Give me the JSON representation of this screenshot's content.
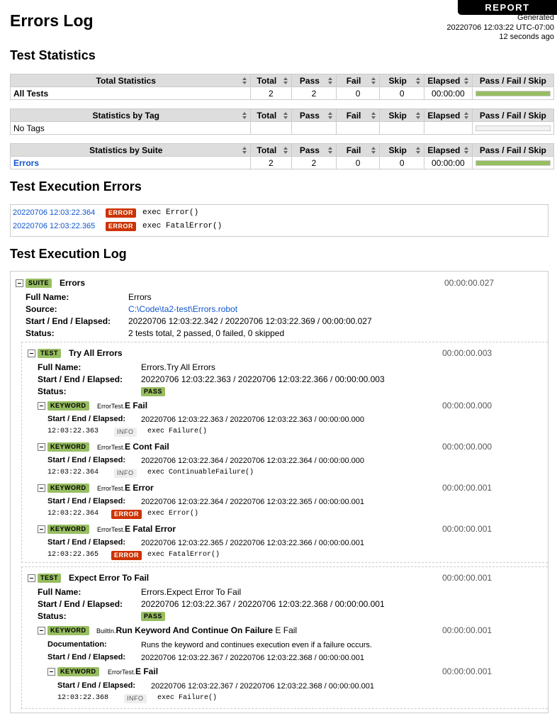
{
  "header": {
    "report_link": "REPORT",
    "title": "Errors Log",
    "generated_label": "Generated",
    "generated_time": "20220706 12:03:22 UTC-07:00",
    "generated_ago": "12 seconds ago"
  },
  "statistics": {
    "heading": "Test Statistics",
    "columns": [
      "Total",
      "Pass",
      "Fail",
      "Skip",
      "Elapsed",
      "Pass / Fail / Skip"
    ],
    "total": {
      "header": "Total Statistics",
      "row": {
        "name": "All Tests",
        "total": "2",
        "pass": "2",
        "fail": "0",
        "skip": "0",
        "elapsed": "00:00:00",
        "pass_ratio": 1.0
      }
    },
    "tag": {
      "header": "Statistics by Tag",
      "row": {
        "name": "No Tags",
        "total": "",
        "pass": "",
        "fail": "",
        "skip": "",
        "elapsed": "",
        "pass_ratio": 0
      }
    },
    "suite": {
      "header": "Statistics by Suite",
      "row": {
        "name": "Errors",
        "total": "2",
        "pass": "2",
        "fail": "0",
        "skip": "0",
        "elapsed": "00:00:00",
        "pass_ratio": 1.0
      }
    }
  },
  "execution_errors": {
    "heading": "Test Execution Errors",
    "rows": [
      {
        "timestamp": "20220706 12:03:22.364",
        "level": "ERROR",
        "message": "exec Error()"
      },
      {
        "timestamp": "20220706 12:03:22.365",
        "level": "ERROR",
        "message": "exec FatalError()"
      }
    ]
  },
  "log": {
    "heading": "Test Execution Log",
    "suite": {
      "label": "SUITE",
      "name": "Errors",
      "elapsed": "00:00:00.027",
      "full_name_key": "Full Name:",
      "full_name": "Errors",
      "source_key": "Source:",
      "source": "C:\\Code\\ta2-test\\Errors.robot",
      "times_key": "Start / End / Elapsed:",
      "times": "20220706 12:03:22.342 / 20220706 12:03:22.369 / 00:00:00.027",
      "status_key": "Status:",
      "status": "2 tests total, 2 passed, 0 failed, 0 skipped"
    },
    "test1": {
      "label": "TEST",
      "name": "Try All Errors",
      "elapsed": "00:00:00.003",
      "full_name_key": "Full Name:",
      "full_name": "Errors.Try All Errors",
      "times_key": "Start / End / Elapsed:",
      "times": "20220706 12:03:22.363 / 20220706 12:03:22.366 / 00:00:00.003",
      "status_key": "Status:",
      "status": "PASS",
      "keywords": [
        {
          "label": "KEYWORD",
          "lib": "ErrorTest.",
          "name": "E Fail",
          "elapsed": "00:00:00.000",
          "times_key": "Start / End / Elapsed:",
          "times": "20220706 12:03:22.363 / 20220706 12:03:22.363 / 00:00:00.000",
          "msg_ts": "12:03:22.363",
          "level": "INFO",
          "msg": "exec Failure()"
        },
        {
          "label": "KEYWORD",
          "lib": "ErrorTest.",
          "name": "E Cont Fail",
          "elapsed": "00:00:00.000",
          "times_key": "Start / End / Elapsed:",
          "times": "20220706 12:03:22.364 / 20220706 12:03:22.364 / 00:00:00.000",
          "msg_ts": "12:03:22.364",
          "level": "INFO",
          "msg": "exec ContinuableFailure()"
        },
        {
          "label": "KEYWORD",
          "lib": "ErrorTest.",
          "name": "E Error",
          "elapsed": "00:00:00.001",
          "times_key": "Start / End / Elapsed:",
          "times": "20220706 12:03:22.364 / 20220706 12:03:22.365 / 00:00:00.001",
          "msg_ts": "12:03:22.364",
          "level": "ERROR",
          "msg": "exec Error()"
        },
        {
          "label": "KEYWORD",
          "lib": "ErrorTest.",
          "name": "E Fatal Error",
          "elapsed": "00:00:00.001",
          "times_key": "Start / End / Elapsed:",
          "times": "20220706 12:03:22.365 / 20220706 12:03:22.366 / 00:00:00.001",
          "msg_ts": "12:03:22.365",
          "level": "ERROR",
          "msg": "exec FatalError()"
        }
      ]
    },
    "test2": {
      "label": "TEST",
      "name": "Expect Error To Fail",
      "elapsed": "00:00:00.001",
      "full_name_key": "Full Name:",
      "full_name": "Errors.Expect Error To Fail",
      "times_key": "Start / End / Elapsed:",
      "times": "20220706 12:03:22.367 / 20220706 12:03:22.368 / 00:00:00.001",
      "status_key": "Status:",
      "status": "PASS",
      "keyword": {
        "label": "KEYWORD",
        "lib": "BuiltIn.",
        "name": "Run Keyword And Continue On Failure",
        "args": "E Fail",
        "elapsed": "00:00:00.001",
        "doc_key": "Documentation:",
        "doc": "Runs the keyword and continues execution even if a failure occurs.",
        "times_key": "Start / End / Elapsed:",
        "times": "20220706 12:03:22.367 / 20220706 12:03:22.368 / 00:00:00.001",
        "child": {
          "label": "KEYWORD",
          "lib": "ErrorTest.",
          "name": "E Fail",
          "elapsed": "00:00:00.001",
          "times_key": "Start / End / Elapsed:",
          "times": "20220706 12:03:22.367 / 20220706 12:03:22.368 / 00:00:00.001",
          "msg_ts": "12:03:22.368",
          "level": "INFO",
          "msg": "exec Failure()"
        }
      }
    }
  }
}
